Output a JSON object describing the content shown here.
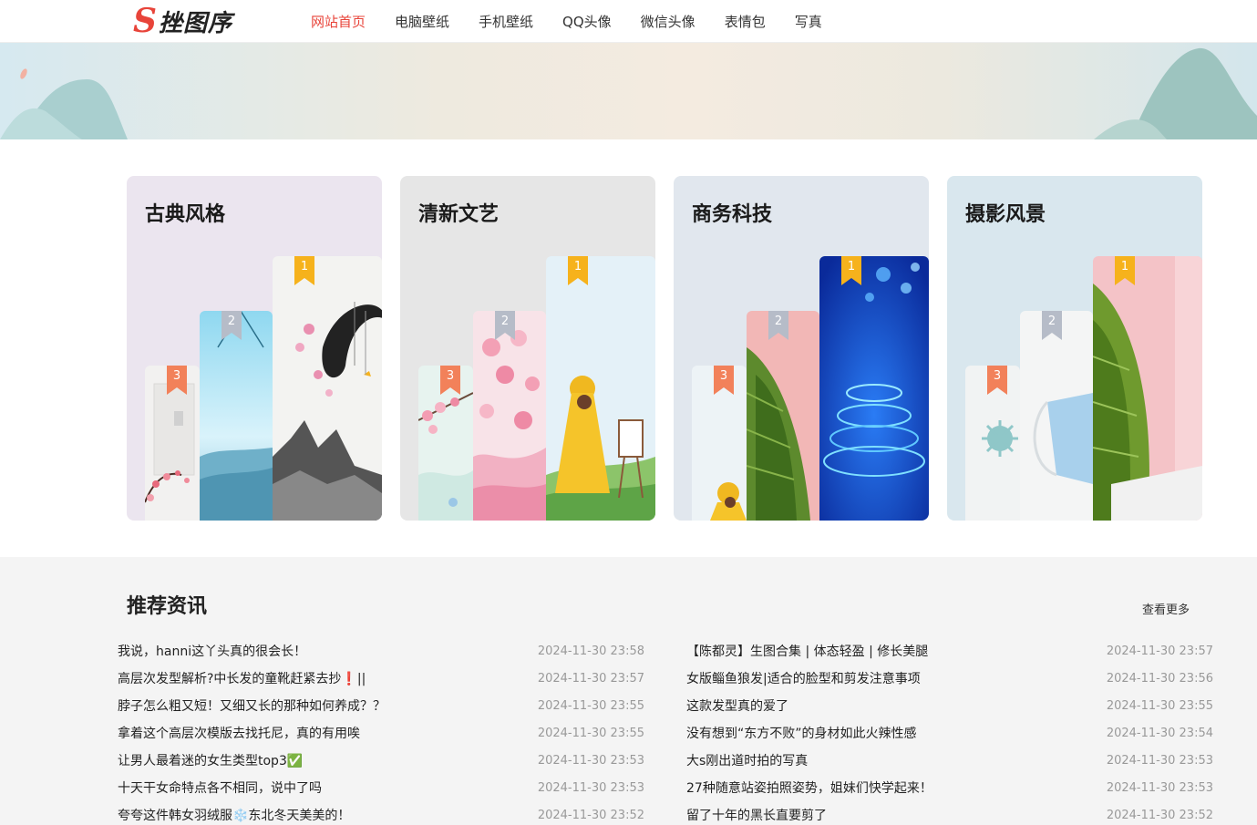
{
  "header": {
    "logo_mark": "S",
    "logo_text": "挫图序",
    "nav": [
      {
        "label": "网站首页",
        "active": true
      },
      {
        "label": "电脑壁纸",
        "active": false
      },
      {
        "label": "手机壁纸",
        "active": false
      },
      {
        "label": "QQ头像",
        "active": false
      },
      {
        "label": "微信头像",
        "active": false
      },
      {
        "label": "表情包",
        "active": false
      },
      {
        "label": "写真",
        "active": false
      }
    ]
  },
  "categories": [
    {
      "title": "古典风格",
      "bg": "#ebe5ef",
      "ranks": [
        "3",
        "2",
        "1"
      ]
    },
    {
      "title": "清新文艺",
      "bg": "#e6e6e6",
      "ranks": [
        "3",
        "2",
        "1"
      ]
    },
    {
      "title": "商务科技",
      "bg": "#e1e7ee",
      "ranks": [
        "3",
        "2",
        "1"
      ]
    },
    {
      "title": "摄影风景",
      "bg": "#d9e7ee",
      "ranks": [
        "3",
        "2",
        "1"
      ]
    }
  ],
  "colors": {
    "accent": "#e8443a",
    "rank1": "#f6b21c",
    "rank2": "#b6bcc8",
    "rank3": "#f2815a"
  },
  "news": {
    "title": "推荐资讯",
    "more": "查看更多",
    "left": [
      {
        "text": "我说，hanni这丫头真的很会长！",
        "date": "2024-11-30 23:58"
      },
      {
        "text": "高层次发型解析?中长发的童靴赶紧去抄❗||",
        "date": "2024-11-30 23:57"
      },
      {
        "text": "脖子怎么粗又短！又细又长的那种如何养成？？",
        "date": "2024-11-30 23:55"
      },
      {
        "text": "拿着这个高层次模版去找托尼，真的有用唉",
        "date": "2024-11-30 23:55"
      },
      {
        "text": "让男人最着迷的女生类型top3✅",
        "date": "2024-11-30 23:53"
      },
      {
        "text": "十天干女命特点各不相同，说中了吗",
        "date": "2024-11-30 23:53"
      },
      {
        "text": "夸夸这件韩女羽绒服❄️东北冬天美美的！",
        "date": "2024-11-30 23:52"
      }
    ],
    "right": [
      {
        "text": "【陈都灵】生图合集 | 体态轻盈 | 修长美腿",
        "date": "2024-11-30 23:57"
      },
      {
        "text": "女版鲻鱼狼发|适合的脸型和剪发注意事项",
        "date": "2024-11-30 23:56"
      },
      {
        "text": "这款发型真的爱了",
        "date": "2024-11-30 23:55"
      },
      {
        "text": "没有想到“东方不败”的身材如此火辣性感",
        "date": "2024-11-30 23:54"
      },
      {
        "text": "大s刚出道时拍的写真",
        "date": "2024-11-30 23:53"
      },
      {
        "text": "27种随意站姿拍照姿势，姐妹们快学起来！",
        "date": "2024-11-30 23:53"
      },
      {
        "text": "留了十年的黑长直要剪了",
        "date": "2024-11-30 23:52"
      }
    ]
  }
}
